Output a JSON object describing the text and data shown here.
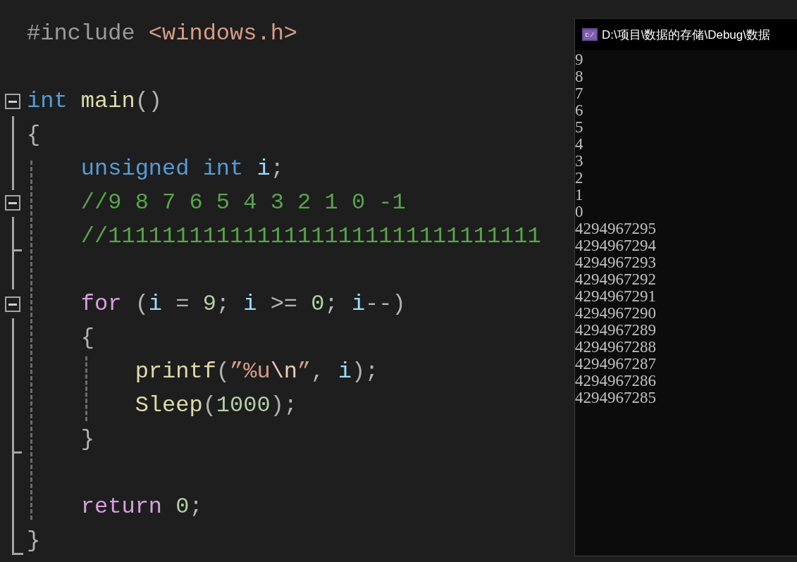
{
  "editor": {
    "lines": [
      {
        "kind": "code",
        "tokens": [
          {
            "text": "#include ",
            "kind": "preproc"
          },
          {
            "text": "<windows.h>",
            "kind": "path"
          }
        ]
      },
      {
        "kind": "blank"
      },
      {
        "kind": "code",
        "fold": {
          "expanded": true
        },
        "tokens": [
          {
            "text": "int ",
            "kind": "type"
          },
          {
            "text": "main",
            "kind": "function"
          },
          {
            "text": "()",
            "kind": "punct"
          }
        ]
      },
      {
        "kind": "code",
        "tokens": [
          {
            "text": "{",
            "kind": "punct"
          }
        ]
      },
      {
        "kind": "code",
        "tokens": [
          {
            "text": "    unsigned int ",
            "kind": "type"
          },
          {
            "text": "i",
            "kind": "variable"
          },
          {
            "text": ";",
            "kind": "punct"
          }
        ]
      },
      {
        "kind": "code",
        "fold": {
          "expanded": true
        },
        "tokens": [
          {
            "text": "    //9 8 7 6 5 4 3 2 1 0 -1",
            "kind": "comment"
          }
        ]
      },
      {
        "kind": "code",
        "tokens": [
          {
            "text": "    //11111111111111111111111111111111",
            "kind": "comment"
          }
        ]
      },
      {
        "kind": "blank"
      },
      {
        "kind": "code",
        "fold": {
          "expanded": true
        },
        "tokens": [
          {
            "text": "    for",
            "kind": "control"
          },
          {
            "text": " (",
            "kind": "punct"
          },
          {
            "text": "i",
            "kind": "variable"
          },
          {
            "text": " = ",
            "kind": "punct"
          },
          {
            "text": "9",
            "kind": "number"
          },
          {
            "text": "; ",
            "kind": "punct"
          },
          {
            "text": "i",
            "kind": "variable"
          },
          {
            "text": " >= ",
            "kind": "punct"
          },
          {
            "text": "0",
            "kind": "number"
          },
          {
            "text": "; ",
            "kind": "punct"
          },
          {
            "text": "i",
            "kind": "variable"
          },
          {
            "text": "--)",
            "kind": "punct"
          }
        ]
      },
      {
        "kind": "code",
        "tokens": [
          {
            "text": "    {",
            "kind": "punct"
          }
        ]
      },
      {
        "kind": "code",
        "tokens": [
          {
            "text": "        printf",
            "kind": "function"
          },
          {
            "text": "(",
            "kind": "punct"
          },
          {
            "text": "”%u",
            "kind": "string"
          },
          {
            "text": "\\n",
            "kind": "escape"
          },
          {
            "text": "”",
            "kind": "string"
          },
          {
            "text": ", ",
            "kind": "punct"
          },
          {
            "text": "i",
            "kind": "variable"
          },
          {
            "text": ");",
            "kind": "punct"
          }
        ]
      },
      {
        "kind": "code",
        "tokens": [
          {
            "text": "        Sleep",
            "kind": "function"
          },
          {
            "text": "(",
            "kind": "punct"
          },
          {
            "text": "1000",
            "kind": "number"
          },
          {
            "text": ");",
            "kind": "punct"
          }
        ]
      },
      {
        "kind": "code",
        "tokens": [
          {
            "text": "    }",
            "kind": "punct"
          }
        ]
      },
      {
        "kind": "blank"
      },
      {
        "kind": "code",
        "tokens": [
          {
            "text": "    return ",
            "kind": "control"
          },
          {
            "text": "0",
            "kind": "number"
          },
          {
            "text": ";",
            "kind": "punct"
          }
        ]
      },
      {
        "kind": "code",
        "tokens": [
          {
            "text": "}",
            "kind": "punct"
          }
        ]
      }
    ]
  },
  "console": {
    "title": "D:\\项目\\数据的存储\\Debug\\数据",
    "output": [
      "9",
      "8",
      "7",
      "6",
      "5",
      "4",
      "3",
      "2",
      "1",
      "0",
      "4294967295",
      "4294967294",
      "4294967293",
      "4294967292",
      "4294967291",
      "4294967290",
      "4294967289",
      "4294967288",
      "4294967287",
      "4294967286",
      "4294967285"
    ]
  }
}
